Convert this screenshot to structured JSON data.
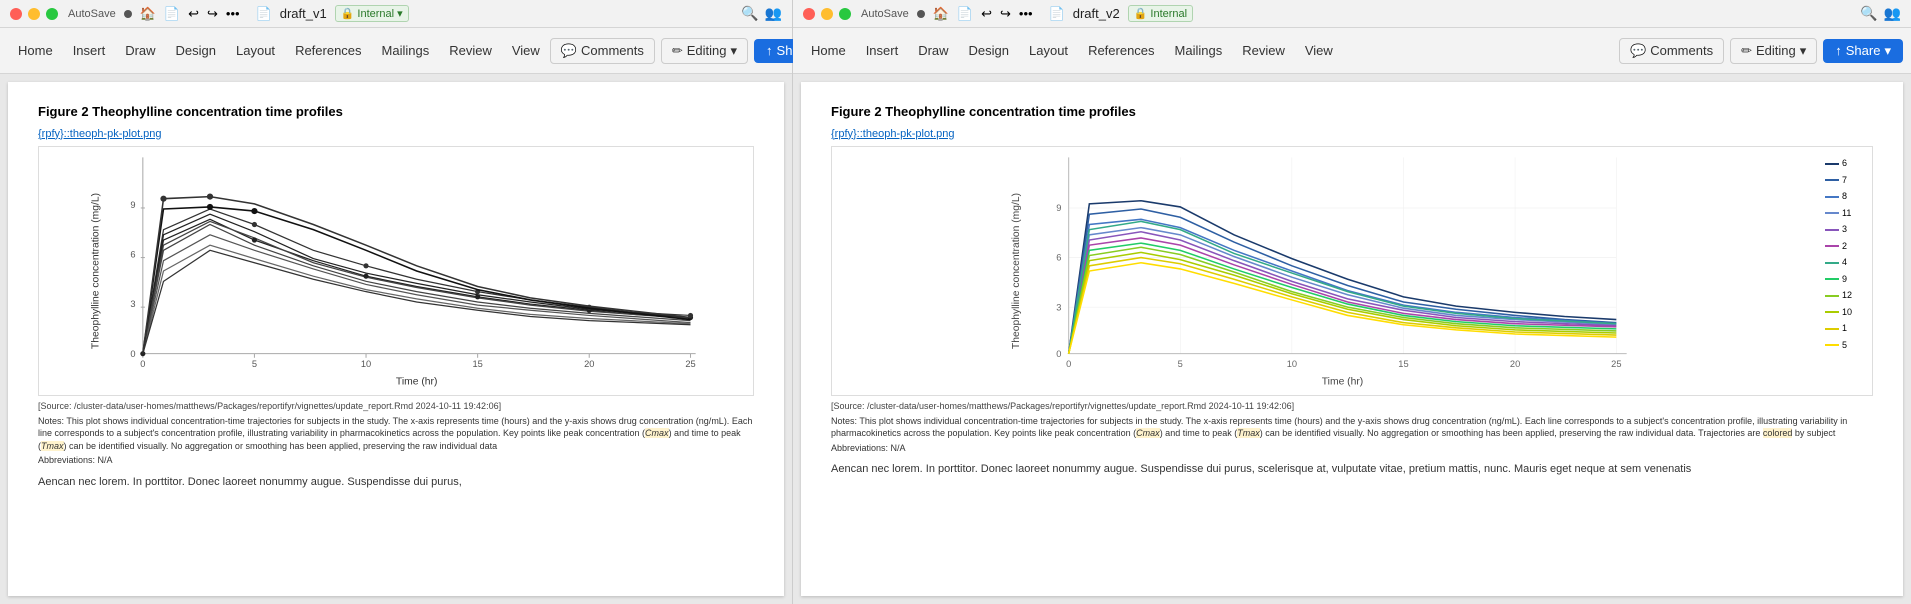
{
  "left_window": {
    "title": "draft_v1",
    "badge": "Internal",
    "autosave": "AutoSave",
    "tabs": [
      "Home",
      "Insert",
      "Draw",
      "Design",
      "Layout",
      "References",
      "Mailings",
      "Review",
      "View"
    ],
    "comments_label": "Comments",
    "editing_label": "Editing",
    "share_label": "Share",
    "figure_title": "Figure 2 Theophylline concentration time profiles",
    "ref_link": "{rpfy}::theoph-pk-plot.png",
    "source_line": "[Source: /cluster-data/user-homes/matthews/Packages/reportifyr/vignettes/update_report.Rmd 2024-10-11 19:42:06]",
    "notes_line": "Notes: This plot shows individual concentration-time trajectories for subjects in the study. The x-axis represents time (hours) and the y-axis shows drug concentration (ng/mL). Each line corresponds to a subject's concentration profile, illustrating variability in pharmacokinetics across the population. Key points like peak concentration (Cmax) and time to peak (Tmax) can be identified visually. No aggregation or smoothing has been applied, preserving the raw individual data",
    "abbrev_line": "Abbreviations: N/A",
    "body_text": "Aencan nec lorem. In porttitor. Donec laoreet nonummy augue. Suspendisse dui purus,",
    "chart": {
      "x_label": "Time (hr)",
      "y_label": "Theophylline concentration (mg/L)",
      "x_ticks": [
        "0",
        "5",
        "10",
        "15",
        "20",
        "25"
      ],
      "y_ticks": [
        "0",
        "3",
        "6",
        "9"
      ]
    }
  },
  "right_window": {
    "title": "draft_v2",
    "badge": "Internal",
    "autosave": "AutoSave",
    "tabs": [
      "Home",
      "Insert",
      "Draw",
      "Design",
      "Layout",
      "References",
      "Mailings",
      "Review",
      "View"
    ],
    "comments_label": "Comments",
    "editing_label": "Editing",
    "share_label": "Share",
    "figure_title": "Figure 2 Theophylline concentration time profiles",
    "ref_link": "{rpfy}::theoph-pk-plot.png",
    "source_line": "[Source: /cluster-data/user-homes/matthews/Packages/reportifyr/vignettes/update_report.Rmd 2024-10-11 19:42:06]",
    "notes_line": "Notes: This plot shows individual concentration-time trajectories for subjects in the study. The x-axis represents time (hours) and the y-axis shows drug concentration (ng/mL). Each line corresponds to a subject's concentration profile, illustrating variability in pharmacokinetics across the population. Key points like peak concentration (Cmax) and time to peak (Tmax) can be identified visually. No aggregation or smoothing has been applied, preserving the raw individual data. Trajectories are colored by subject",
    "abbrev_line": "Abbreviations: N/A",
    "body_text": "Aencan nec lorem. In porttitor. Donec laoreet nonummy augue. Suspendisse dui purus, scelerisque at, vulputate vitae, pretium mattis, nunc. Mauris eget neque at sem venenatis",
    "chart": {
      "x_label": "Time (hr)",
      "y_label": "Theophylline concentration (mg/L)",
      "x_ticks": [
        "0",
        "5",
        "10",
        "15",
        "20",
        "25"
      ],
      "y_ticks": [
        "0",
        "3",
        "6",
        "9"
      ],
      "legend": [
        {
          "id": "6",
          "color": "#1a3a6b"
        },
        {
          "id": "7",
          "color": "#2e5fa3"
        },
        {
          "id": "8",
          "color": "#4477c4"
        },
        {
          "id": "11",
          "color": "#6688cc"
        },
        {
          "id": "3",
          "color": "#8855bb"
        },
        {
          "id": "2",
          "color": "#aa44aa"
        },
        {
          "id": "4",
          "color": "#33aa88"
        },
        {
          "id": "9",
          "color": "#22cc66"
        },
        {
          "id": "12",
          "color": "#88cc22"
        },
        {
          "id": "10",
          "color": "#aacc00"
        },
        {
          "id": "1",
          "color": "#ddcc00"
        },
        {
          "id": "5",
          "color": "#ffee00"
        }
      ]
    }
  },
  "icons": {
    "pencil": "✏",
    "share": "↑",
    "comment": "💬",
    "search": "🔍",
    "people": "👥",
    "home": "🏠",
    "file": "📄",
    "undo": "↩",
    "redo": "↪",
    "chevron_down": "▾",
    "lock": "🔒"
  }
}
